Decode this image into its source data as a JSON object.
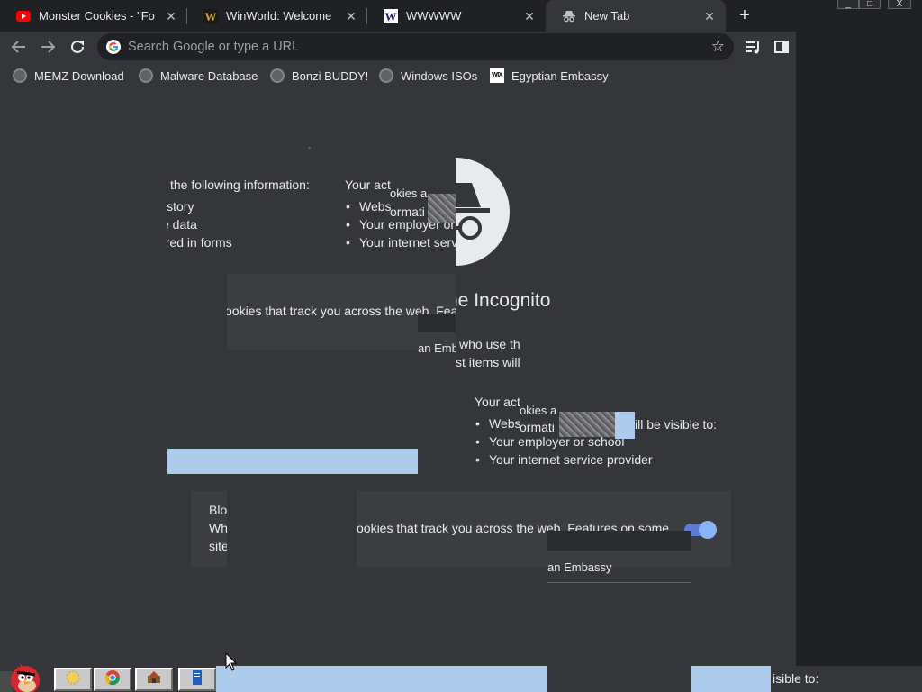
{
  "tabs": [
    {
      "title": "Monster Cookies - \"Fo",
      "icon": "youtube-icon"
    },
    {
      "title": "WinWorld: Welcome",
      "icon": "winworld-icon"
    },
    {
      "title": "WWWWW",
      "icon": "w-site-icon"
    },
    {
      "title": "New Tab",
      "icon": "incognito-icon",
      "active": true
    }
  ],
  "window_controls": [
    "_",
    "□",
    "X"
  ],
  "omnibox": {
    "placeholder": "Search Google or type a URL"
  },
  "bookmarks": [
    {
      "label": "MEMZ Download",
      "icon": "globe-icon"
    },
    {
      "label": "Malware Database",
      "icon": "globe-icon"
    },
    {
      "label": "Bonzi BUDDY!",
      "icon": "globe-icon"
    },
    {
      "label": "Windows ISOs",
      "icon": "globe-icon"
    },
    {
      "label": "Egyptian Embassy",
      "icon": "wix-icon"
    }
  ],
  "page": {
    "heading_fragment": "ne Incognito",
    "info_intro": "the following information:",
    "info_items": [
      "istory",
      "e data",
      "ered in forms"
    ],
    "activity_header": "Your act",
    "activity_items": [
      "Webs",
      "Your employer or",
      "Your internet serv"
    ],
    "overlay_cookies": "okies a",
    "overlay_information": "ormati",
    "cookies_fragment_1": "ookies that track you across the web. Featu",
    "embassy_fragment_1": "an Embass",
    "who_use": "who use th",
    "list_items": "st items will",
    "activity_header_2": "Your act",
    "activity_items_2": [
      "Webs",
      "Your employer or school",
      "Your internet service provider"
    ],
    "overlay_cookies_2": "okies a",
    "overlay_information_2": "ormati",
    "visible_to": "ill be visible to:",
    "card_lines": [
      "Blo",
      "Wh",
      "site"
    ],
    "cookies_fragment_2": "ookies that track you across the web. Features on some",
    "embassy_fragment_2": "an Embassy",
    "visible_to_bottom": "isible to:"
  },
  "colors": {
    "background": "#35363a",
    "tabstrip": "#202124",
    "toggle": "#8ab4f8",
    "selection_blue": "#aecbeb"
  }
}
